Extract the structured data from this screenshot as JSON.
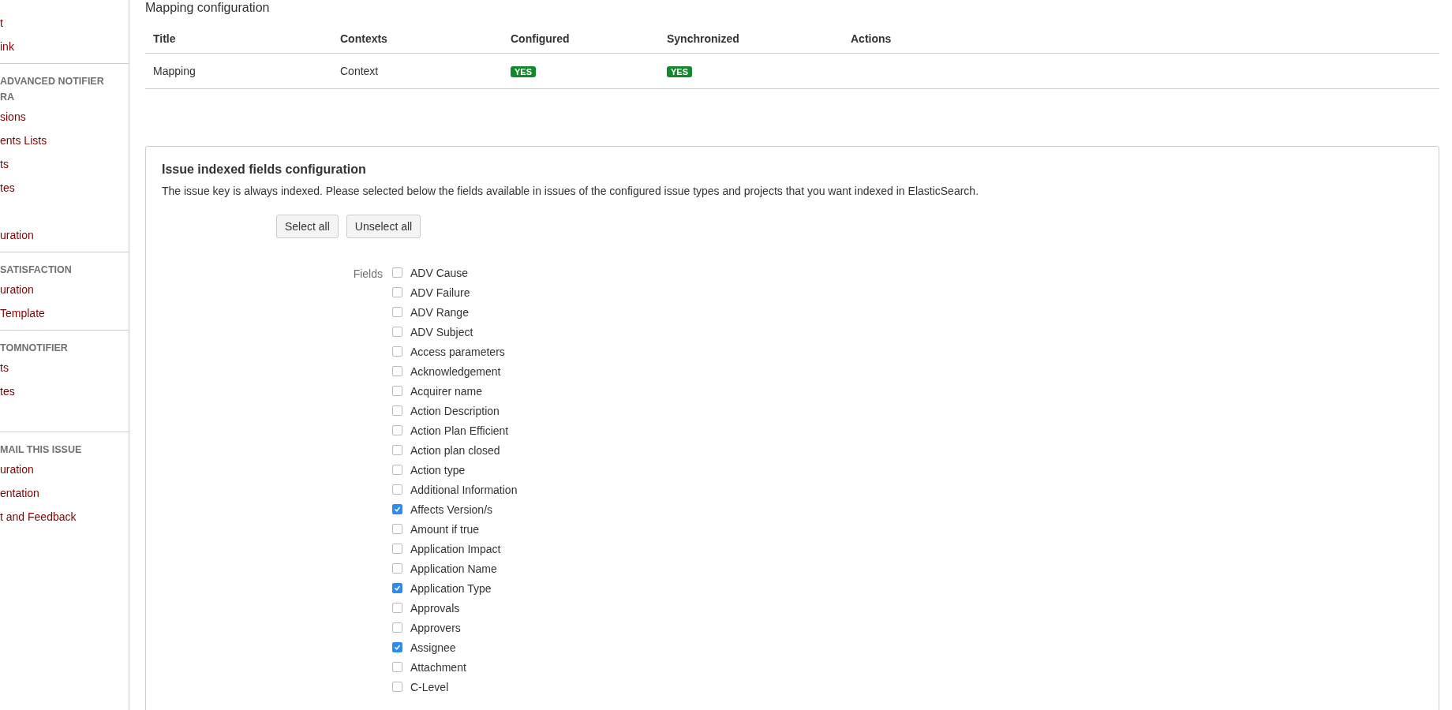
{
  "sidebar": {
    "sections": [
      {
        "groups": [
          [
            "t",
            "ink"
          ]
        ]
      },
      {
        "heading": "ADVANCED NOTIFIER RA",
        "groups": [
          [
            "sions",
            "ents Lists",
            "ts",
            "tes"
          ],
          [
            "uration"
          ]
        ]
      },
      {
        "heading": "SATISFACTION",
        "groups": [
          [
            "uration",
            "Template"
          ]
        ]
      },
      {
        "heading": "TOMNOTIFIER",
        "groups": [
          [
            "ts",
            "tes"
          ]
        ]
      },
      {
        "heading": "MAIL THIS ISSUE",
        "groups": [
          [
            "uration",
            "entation",
            "t and Feedback"
          ]
        ]
      }
    ]
  },
  "mapping": {
    "title": "Mapping configuration",
    "columns": [
      "Title",
      "Contexts",
      "Configured",
      "Synchronized",
      "Actions"
    ],
    "rows": [
      {
        "title": "Mapping",
        "contexts": "Context",
        "configured": "YES",
        "synchronized": "YES"
      }
    ]
  },
  "fields_panel": {
    "title": "Issue indexed fields configuration",
    "description": "The issue key is always indexed. Please selected below the fields available in issues of the configured issue types and projects that you want indexed in ElasticSearch.",
    "buttons": [
      "Select all",
      "Unselect all"
    ],
    "fields_label": "Fields",
    "fields": [
      {
        "label": "ADV Cause",
        "checked": false
      },
      {
        "label": "ADV Failure",
        "checked": false
      },
      {
        "label": "ADV Range",
        "checked": false
      },
      {
        "label": "ADV Subject",
        "checked": false
      },
      {
        "label": "Access parameters",
        "checked": false
      },
      {
        "label": "Acknowledgement",
        "checked": false
      },
      {
        "label": "Acquirer name",
        "checked": false
      },
      {
        "label": "Action Description",
        "checked": false
      },
      {
        "label": "Action Plan Efficient",
        "checked": false
      },
      {
        "label": "Action plan closed",
        "checked": false
      },
      {
        "label": "Action type",
        "checked": false
      },
      {
        "label": "Additional Information",
        "checked": false
      },
      {
        "label": "Affects Version/s",
        "checked": true
      },
      {
        "label": "Amount if true",
        "checked": false
      },
      {
        "label": "Application Impact",
        "checked": false
      },
      {
        "label": "Application Name",
        "checked": false
      },
      {
        "label": "Application Type",
        "checked": true
      },
      {
        "label": "Approvals",
        "checked": false
      },
      {
        "label": "Approvers",
        "checked": false
      },
      {
        "label": "Assignee",
        "checked": true
      },
      {
        "label": "Attachment",
        "checked": false
      },
      {
        "label": "C-Level",
        "checked": false
      }
    ]
  }
}
